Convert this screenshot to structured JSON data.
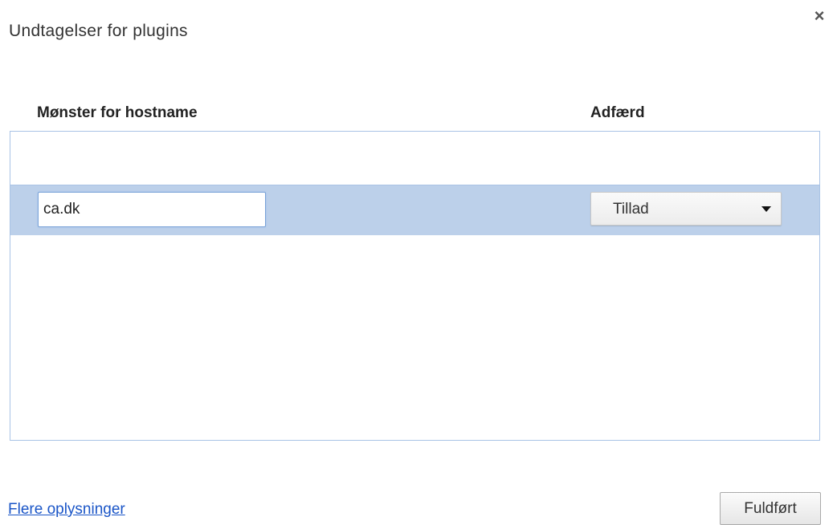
{
  "dialog": {
    "title": "Undtagelser for plugins",
    "close_icon": "close-icon",
    "close_glyph": "×"
  },
  "table": {
    "columns": {
      "pattern": "Mønster for hostname",
      "behavior": "Adfærd"
    },
    "rows": [
      {
        "pattern_value": "ca.dk",
        "behavior_value": "Tillad",
        "selected": true
      }
    ]
  },
  "footer": {
    "link_label": "Flere oplysninger",
    "done_label": "Fuldført"
  },
  "colors": {
    "selected_row": "#bcd0ea",
    "list_border": "#a9c3e6",
    "link": "#1a55c7"
  }
}
